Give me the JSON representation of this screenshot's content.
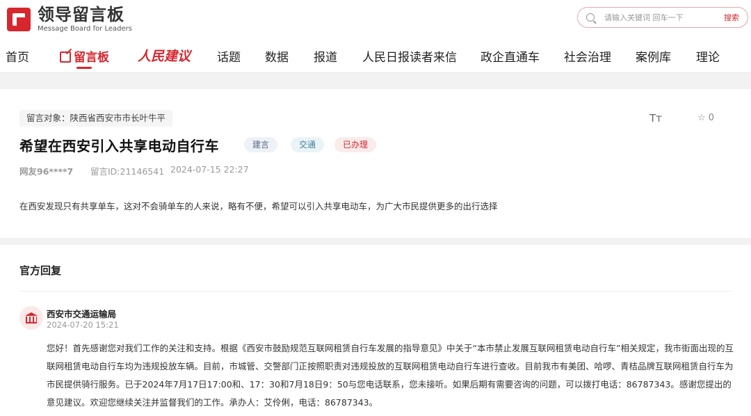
{
  "header": {
    "logo_title": "领导留言板",
    "logo_subtitle": "Message Board for Leaders",
    "search_placeholder": "请输入关键词 回车一下",
    "search_button": "搜索"
  },
  "nav": {
    "items": [
      {
        "label": "首页"
      },
      {
        "label": "留言板"
      },
      {
        "label": "人民建议"
      },
      {
        "label": "话题"
      },
      {
        "label": "数据"
      },
      {
        "label": "报道"
      },
      {
        "label": "人民日报读者来信"
      },
      {
        "label": "政企直通车"
      },
      {
        "label": "社会治理"
      },
      {
        "label": "案例库"
      },
      {
        "label": "理论"
      }
    ],
    "active": "留言板"
  },
  "message": {
    "target": "留言对象：陕西省西安市市长叶牛平",
    "font_tool": "Tт",
    "favorites": "0",
    "title": "希望在西安引入共享电动自行车",
    "tags": [
      "建言",
      "交通",
      "已办理"
    ],
    "user": "网友96****7",
    "message_id": "留言ID:21146541",
    "time": "2024-07-15 22:27",
    "content": "在西安发现只有共享单车，这对不会骑单车的人来说，略有不便，希望可以引入共享电动车，为广大市民提供更多的出行选择"
  },
  "reply": {
    "heading": "官方回复",
    "org": "西安市交通运输局",
    "time": "2024-07-20 15:21",
    "body": "您好！首先感谢您对我们工作的关注和支持。根据《西安市鼓励规范互联网租赁自行车发展的指导意见》中关于“本市禁止发展互联网租赁电动自行车”相关规定，我市街面出现的互联网租赁电动自行车均为违规投放车辆。目前，市城管、交警部门正按照职责对违规投放的互联网租赁电动自行车进行查收。目前我市有美团、哈啰、青桔品牌互联网租赁自行车为市民提供骑行服务。已于2024年7月17日17:00和、17：30和7月18日9：50与您电话联系，您未接听。如果后期有需要咨询的问题，可以拨打电话：86787343。感谢您提出的意见建议。欢迎您继续关注并监督我们的工作。承办人：艾伶俐，电话：86787343。"
  },
  "colors": {
    "accent": "#d7262e"
  }
}
